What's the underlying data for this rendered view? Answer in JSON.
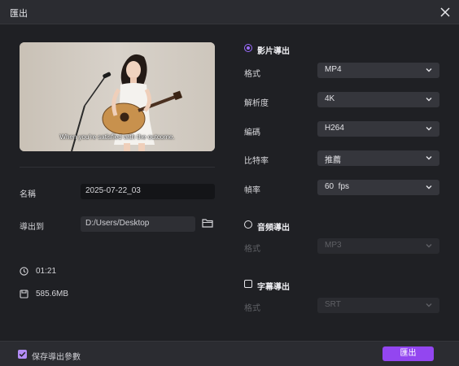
{
  "window": {
    "title": "匯出"
  },
  "preview": {
    "subtitle": "When you're satisfied with the outcome."
  },
  "left": {
    "name_label": "名稱",
    "name_value": "2025-07-22_03",
    "export_to_label": "導出到",
    "export_path": "D:/Users/Desktop",
    "duration": "01:21",
    "size": "585.6MB"
  },
  "video_export": {
    "label": "影片導出",
    "selected": true,
    "rows": [
      {
        "label": "格式",
        "value": "MP4"
      },
      {
        "label": "解析度",
        "value": "4K"
      },
      {
        "label": "編碼",
        "value": "H264"
      },
      {
        "label": "比特率",
        "value": "推薦"
      },
      {
        "label": "幀率",
        "value": "60  fps"
      }
    ]
  },
  "audio_export": {
    "label": "音頻導出",
    "selected": false,
    "format_label": "格式",
    "format_value": "MP3"
  },
  "subtitle_export": {
    "label": "字幕導出",
    "checked": false,
    "format_label": "格式",
    "format_value": "SRT"
  },
  "footer": {
    "save_params_label": "保存導出參數",
    "save_params_checked": true,
    "export_button": "匯出"
  },
  "colors": {
    "accent": "#9346f0",
    "background": "#1f2024",
    "titlebar": "#2b2c31"
  },
  "icons": {
    "close": "close-icon",
    "folder": "folder-icon",
    "clock": "clock-icon",
    "file": "file-size-icon",
    "chevron": "chevron-down-icon"
  }
}
